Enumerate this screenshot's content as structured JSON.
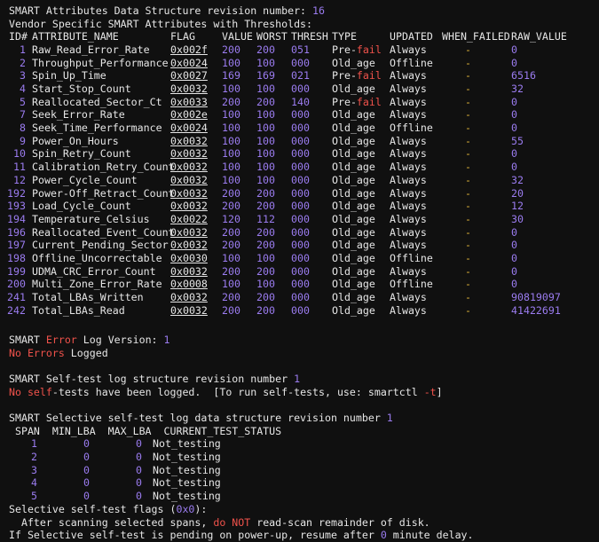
{
  "header": {
    "rev_line_prefix": "SMART Attributes Data Structure revision number: ",
    "rev_number": "16",
    "vendor_line": "Vendor Specific SMART Attributes with Thresholds:"
  },
  "columns": [
    "ID#",
    "ATTRIBUTE_NAME",
    "FLAG",
    "VALUE",
    "WORST",
    "THRESH",
    "TYPE",
    "UPDATED",
    "WHEN_FAILED",
    "RAW_VALUE"
  ],
  "attributes": [
    {
      "id": "1",
      "name": "Raw_Read_Error_Rate",
      "flag": "0x002f",
      "value": "200",
      "worst": "200",
      "thresh": "051",
      "type_prefix": "Pre-",
      "type_suffix": "fail",
      "updated": "Always",
      "when_failed": "-",
      "raw": "0"
    },
    {
      "id": "2",
      "name": "Throughput_Performance",
      "flag": "0x0024",
      "value": "100",
      "worst": "100",
      "thresh": "000",
      "type_prefix": "Old_age",
      "type_suffix": "",
      "updated": "Offline",
      "when_failed": "-",
      "raw": "0"
    },
    {
      "id": "3",
      "name": "Spin_Up_Time",
      "flag": "0x0027",
      "value": "169",
      "worst": "169",
      "thresh": "021",
      "type_prefix": "Pre-",
      "type_suffix": "fail",
      "updated": "Always",
      "when_failed": "-",
      "raw": "6516"
    },
    {
      "id": "4",
      "name": "Start_Stop_Count",
      "flag": "0x0032",
      "value": "100",
      "worst": "100",
      "thresh": "000",
      "type_prefix": "Old_age",
      "type_suffix": "",
      "updated": "Always",
      "when_failed": "-",
      "raw": "32"
    },
    {
      "id": "5",
      "name": "Reallocated_Sector_Ct",
      "flag": "0x0033",
      "value": "200",
      "worst": "200",
      "thresh": "140",
      "type_prefix": "Pre-",
      "type_suffix": "fail",
      "updated": "Always",
      "when_failed": "-",
      "raw": "0"
    },
    {
      "id": "7",
      "name": "Seek_Error_Rate",
      "flag": "0x002e",
      "value": "100",
      "worst": "100",
      "thresh": "000",
      "type_prefix": "Old_age",
      "type_suffix": "",
      "updated": "Always",
      "when_failed": "-",
      "raw": "0"
    },
    {
      "id": "8",
      "name": "Seek_Time_Performance",
      "flag": "0x0024",
      "value": "100",
      "worst": "100",
      "thresh": "000",
      "type_prefix": "Old_age",
      "type_suffix": "",
      "updated": "Offline",
      "when_failed": "-",
      "raw": "0"
    },
    {
      "id": "9",
      "name": "Power_On_Hours",
      "flag": "0x0032",
      "value": "100",
      "worst": "100",
      "thresh": "000",
      "type_prefix": "Old_age",
      "type_suffix": "",
      "updated": "Always",
      "when_failed": "-",
      "raw": "55"
    },
    {
      "id": "10",
      "name": "Spin_Retry_Count",
      "flag": "0x0032",
      "value": "100",
      "worst": "100",
      "thresh": "000",
      "type_prefix": "Old_age",
      "type_suffix": "",
      "updated": "Always",
      "when_failed": "-",
      "raw": "0"
    },
    {
      "id": "11",
      "name": "Calibration_Retry_Count",
      "flag": "0x0032",
      "value": "100",
      "worst": "100",
      "thresh": "000",
      "type_prefix": "Old_age",
      "type_suffix": "",
      "updated": "Always",
      "when_failed": "-",
      "raw": "0"
    },
    {
      "id": "12",
      "name": "Power_Cycle_Count",
      "flag": "0x0032",
      "value": "100",
      "worst": "100",
      "thresh": "000",
      "type_prefix": "Old_age",
      "type_suffix": "",
      "updated": "Always",
      "when_failed": "-",
      "raw": "32"
    },
    {
      "id": "192",
      "name": "Power-Off_Retract_Count",
      "flag": "0x0032",
      "value": "200",
      "worst": "200",
      "thresh": "000",
      "type_prefix": "Old_age",
      "type_suffix": "",
      "updated": "Always",
      "when_failed": "-",
      "raw": "20"
    },
    {
      "id": "193",
      "name": "Load_Cycle_Count",
      "flag": "0x0032",
      "value": "200",
      "worst": "200",
      "thresh": "000",
      "type_prefix": "Old_age",
      "type_suffix": "",
      "updated": "Always",
      "when_failed": "-",
      "raw": "12"
    },
    {
      "id": "194",
      "name": "Temperature_Celsius",
      "flag": "0x0022",
      "value": "120",
      "worst": "112",
      "thresh": "000",
      "type_prefix": "Old_age",
      "type_suffix": "",
      "updated": "Always",
      "when_failed": "-",
      "raw": "30"
    },
    {
      "id": "196",
      "name": "Reallocated_Event_Count",
      "flag": "0x0032",
      "value": "200",
      "worst": "200",
      "thresh": "000",
      "type_prefix": "Old_age",
      "type_suffix": "",
      "updated": "Always",
      "when_failed": "-",
      "raw": "0"
    },
    {
      "id": "197",
      "name": "Current_Pending_Sector",
      "flag": "0x0032",
      "value": "200",
      "worst": "200",
      "thresh": "000",
      "type_prefix": "Old_age",
      "type_suffix": "",
      "updated": "Always",
      "when_failed": "-",
      "raw": "0"
    },
    {
      "id": "198",
      "name": "Offline_Uncorrectable",
      "flag": "0x0030",
      "value": "100",
      "worst": "100",
      "thresh": "000",
      "type_prefix": "Old_age",
      "type_suffix": "",
      "updated": "Offline",
      "when_failed": "-",
      "raw": "0"
    },
    {
      "id": "199",
      "name": "UDMA_CRC_Error_Count",
      "flag": "0x0032",
      "value": "200",
      "worst": "200",
      "thresh": "000",
      "type_prefix": "Old_age",
      "type_suffix": "",
      "updated": "Always",
      "when_failed": "-",
      "raw": "0"
    },
    {
      "id": "200",
      "name": "Multi_Zone_Error_Rate",
      "flag": "0x0008",
      "value": "100",
      "worst": "100",
      "thresh": "000",
      "type_prefix": "Old_age",
      "type_suffix": "",
      "updated": "Offline",
      "when_failed": "-",
      "raw": "0"
    },
    {
      "id": "241",
      "name": "Total_LBAs_Written",
      "flag": "0x0032",
      "value": "200",
      "worst": "200",
      "thresh": "000",
      "type_prefix": "Old_age",
      "type_suffix": "",
      "updated": "Always",
      "when_failed": "-",
      "raw": "90819097"
    },
    {
      "id": "242",
      "name": "Total_LBAs_Read",
      "flag": "0x0032",
      "value": "200",
      "worst": "200",
      "thresh": "000",
      "type_prefix": "Old_age",
      "type_suffix": "",
      "updated": "Always",
      "when_failed": "-",
      "raw": "41422691"
    }
  ],
  "error_log": {
    "version_prefix": "SMART ",
    "version_error_word": "Error",
    "version_suffix": " Log Version: ",
    "version_number": "1",
    "no_errors": "No Errors",
    "logged": " Logged"
  },
  "self_test_log": {
    "rev_prefix": "SMART Self-test log structure revision number ",
    "rev_number": "1",
    "no_tests_red": "No self",
    "no_tests_rest": "-tests have been logged.  [To run self-tests, use: smartctl ",
    "flag": "-t",
    "close": "]"
  },
  "selective": {
    "rev_prefix": "SMART Selective self-test log data structure revision number ",
    "rev_number": "1",
    "columns": " SPAN  MIN_LBA  MAX_LBA  CURRENT_TEST_STATUS",
    "spans": [
      {
        "span": "1",
        "min": "0",
        "max": "0",
        "status": "Not_testing"
      },
      {
        "span": "2",
        "min": "0",
        "max": "0",
        "status": "Not_testing"
      },
      {
        "span": "3",
        "min": "0",
        "max": "0",
        "status": "Not_testing"
      },
      {
        "span": "4",
        "min": "0",
        "max": "0",
        "status": "Not_testing"
      },
      {
        "span": "5",
        "min": "0",
        "max": "0",
        "status": "Not_testing"
      }
    ],
    "flags_prefix": "Selective self-test flags (",
    "flags_value": "0x0",
    "flags_suffix": "):",
    "after_prefix": "  After scanning selected spans, ",
    "after_red": "do NOT",
    "after_suffix": " read-scan remainder of disk.",
    "pending_prefix": "If Selective self-test is pending on power-up, resume after ",
    "pending_number": "0",
    "pending_suffix": " minute delay."
  },
  "colors": {
    "background": "#101010",
    "text": "#e6e6e6",
    "number": "#9b7cf0",
    "error": "#f0524b",
    "dash": "#e0b43a"
  }
}
